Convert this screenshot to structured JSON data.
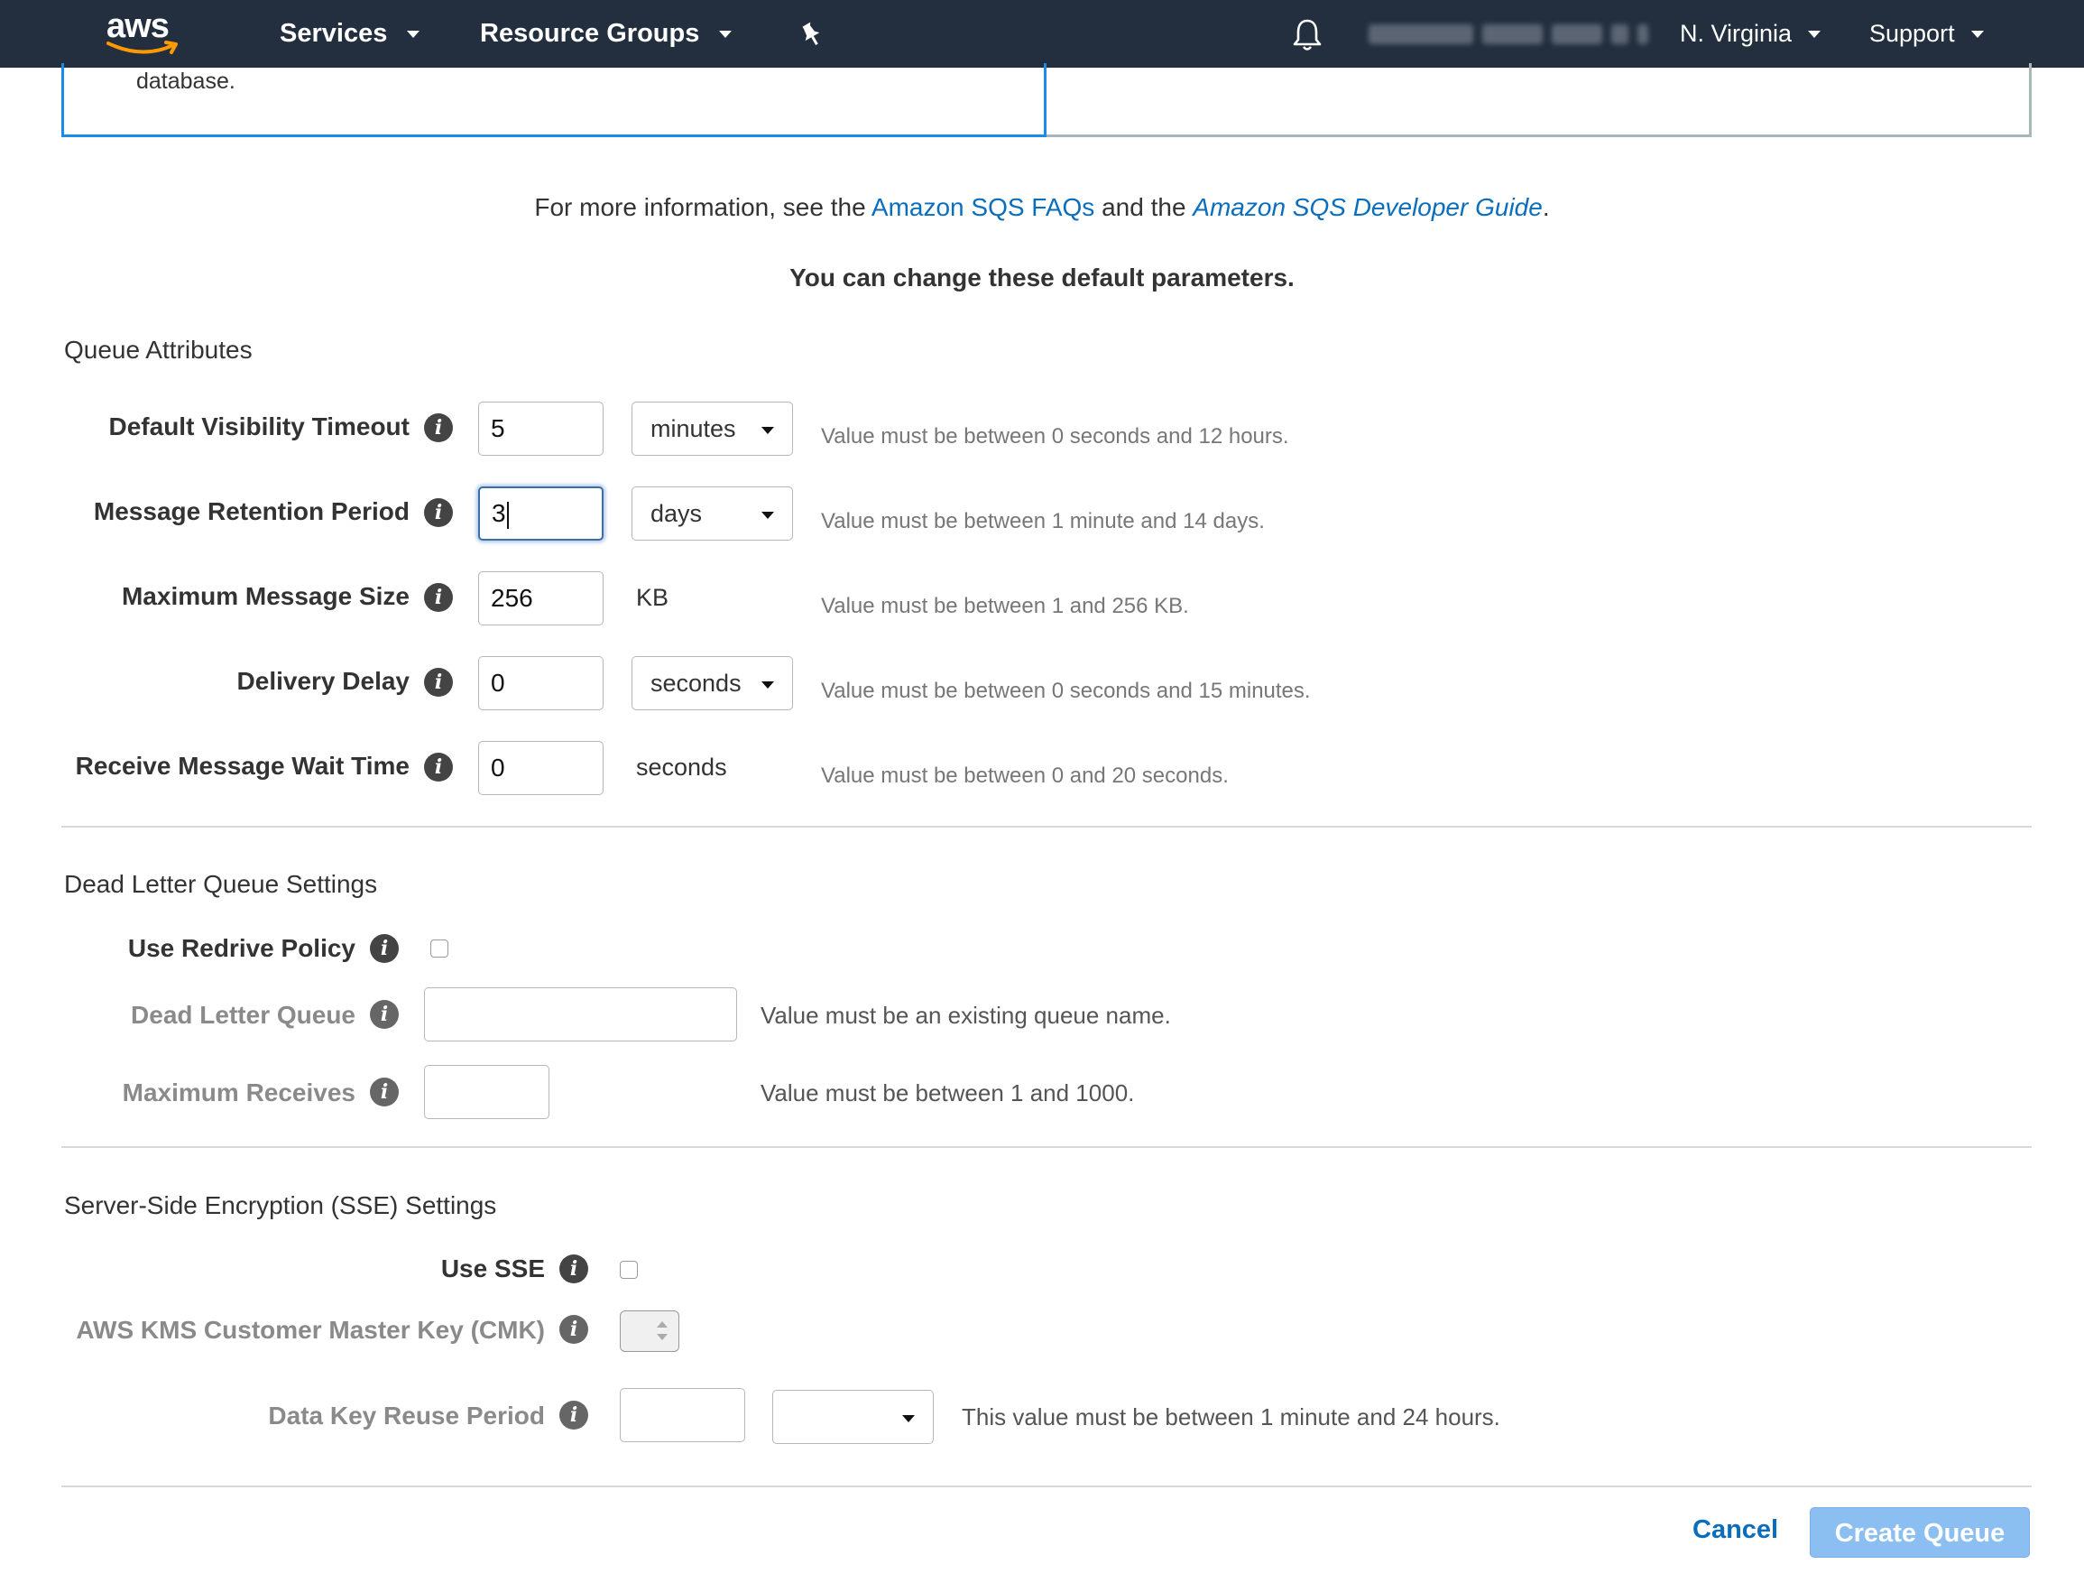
{
  "nav": {
    "logo_text": "aws",
    "services": "Services",
    "resource_groups": "Resource Groups",
    "region": "N. Virginia",
    "support": "Support"
  },
  "tile": {
    "text": "database."
  },
  "info": {
    "prefix": "For more information, see the",
    "faq_link": "Amazon SQS FAQs",
    "middle": "and the",
    "guide_link": "Amazon SQS Developer Guide",
    "suffix": "."
  },
  "subtitle": "You can change these default parameters.",
  "queue_attributes": {
    "title": "Queue Attributes",
    "rows": [
      {
        "label": "Default Visibility Timeout",
        "value": "5",
        "unit": "minutes",
        "hint": "Value must be between 0 seconds and 12 hours."
      },
      {
        "label": "Message Retention Period",
        "value": "3",
        "unit": "days",
        "hint": "Value must be between 1 minute and 14 days."
      },
      {
        "label": "Maximum Message Size",
        "value": "256",
        "unit": "KB",
        "hint": "Value must be between 1 and 256 KB."
      },
      {
        "label": "Delivery Delay",
        "value": "0",
        "unit": "seconds",
        "hint": "Value must be between 0 seconds and 15 minutes."
      },
      {
        "label": "Receive Message Wait Time",
        "value": "0",
        "unit": "seconds",
        "hint": "Value must be between 0 and 20 seconds."
      }
    ]
  },
  "dlq": {
    "title": "Dead Letter Queue Settings",
    "redrive_label": "Use Redrive Policy",
    "queue_label": "Dead Letter Queue",
    "queue_hint": "Value must be an existing queue name.",
    "max_label": "Maximum Receives",
    "max_hint": "Value must be between 1 and 1000."
  },
  "sse": {
    "title": "Server-Side Encryption (SSE) Settings",
    "use_label": "Use SSE",
    "cmk_label": "AWS KMS Customer Master Key (CMK)",
    "reuse_label": "Data Key Reuse Period",
    "reuse_hint": "This value must be between 1 minute and 24 hours."
  },
  "buttons": {
    "cancel": "Cancel",
    "create": "Create Queue"
  },
  "colors": {
    "nav_bg": "#232f3e",
    "link": "#0a6ebd",
    "primary_disabled": "#8bbef1",
    "aws_orange": "#ff9900"
  }
}
